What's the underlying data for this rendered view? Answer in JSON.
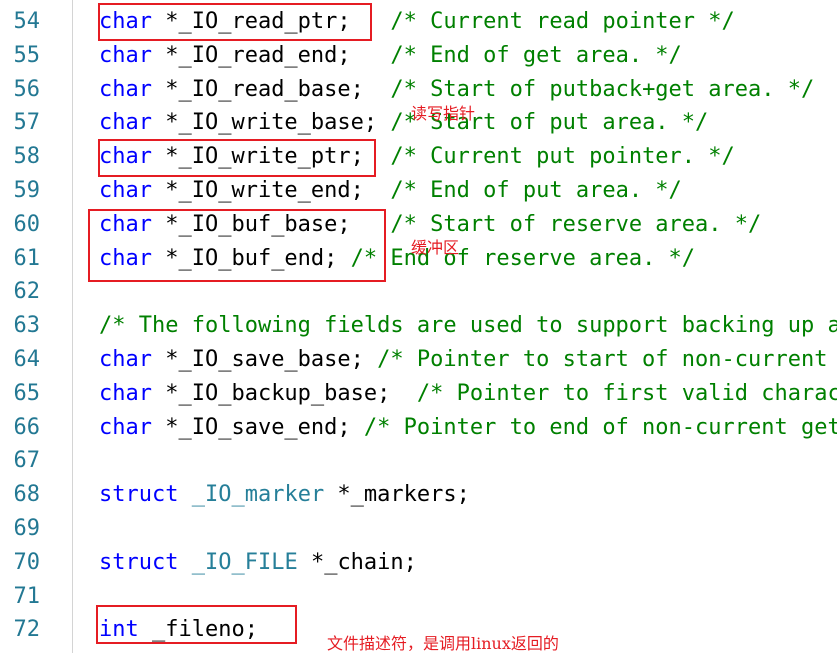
{
  "editor": {
    "lines": [
      {
        "num": "54",
        "parts": [
          {
            "t": "char",
            "c": "kw"
          },
          {
            "t": " *_IO_read_ptr;   ",
            "c": "tx"
          },
          {
            "t": "/* Current read pointer */",
            "c": "cm"
          }
        ]
      },
      {
        "num": "55",
        "parts": [
          {
            "t": "char",
            "c": "kw"
          },
          {
            "t": " *_IO_read_end;   ",
            "c": "tx"
          },
          {
            "t": "/* End of get area. */",
            "c": "cm"
          }
        ]
      },
      {
        "num": "56",
        "parts": [
          {
            "t": "char",
            "c": "kw"
          },
          {
            "t": " *_IO_read_base;  ",
            "c": "tx"
          },
          {
            "t": "/* Start of putback+get area. */",
            "c": "cm"
          }
        ]
      },
      {
        "num": "57",
        "parts": [
          {
            "t": "char",
            "c": "kw"
          },
          {
            "t": " *_IO_write_base; ",
            "c": "tx"
          },
          {
            "t": "/* Start of put area. */",
            "c": "cm"
          }
        ]
      },
      {
        "num": "58",
        "parts": [
          {
            "t": "char",
            "c": "kw"
          },
          {
            "t": " *_IO_write_ptr;  ",
            "c": "tx"
          },
          {
            "t": "/* Current put pointer. */",
            "c": "cm"
          }
        ]
      },
      {
        "num": "59",
        "parts": [
          {
            "t": "char",
            "c": "kw"
          },
          {
            "t": " *_IO_write_end;  ",
            "c": "tx"
          },
          {
            "t": "/* End of put area. */",
            "c": "cm"
          }
        ]
      },
      {
        "num": "60",
        "parts": [
          {
            "t": "char",
            "c": "kw"
          },
          {
            "t": " *_IO_buf_base;   ",
            "c": "tx"
          },
          {
            "t": "/* Start of reserve area. */",
            "c": "cm"
          }
        ]
      },
      {
        "num": "61",
        "parts": [
          {
            "t": "char",
            "c": "kw"
          },
          {
            "t": " *_IO_buf_end; ",
            "c": "tx"
          },
          {
            "t": "/* End of reserve area. */",
            "c": "cm"
          }
        ]
      },
      {
        "num": "62",
        "parts": []
      },
      {
        "num": "63",
        "parts": [
          {
            "t": "/* The following fields are used to support backing up and undo. */",
            "c": "cm"
          }
        ]
      },
      {
        "num": "64",
        "parts": [
          {
            "t": "char",
            "c": "kw"
          },
          {
            "t": " *_IO_save_base; ",
            "c": "tx"
          },
          {
            "t": "/* Pointer to start of non-current get area. */",
            "c": "cm"
          }
        ]
      },
      {
        "num": "65",
        "parts": [
          {
            "t": "char",
            "c": "kw"
          },
          {
            "t": " *_IO_backup_base;  ",
            "c": "tx"
          },
          {
            "t": "/* Pointer to first valid character of backup area */",
            "c": "cm"
          }
        ]
      },
      {
        "num": "66",
        "parts": [
          {
            "t": "char",
            "c": "kw"
          },
          {
            "t": " *_IO_save_end; ",
            "c": "tx"
          },
          {
            "t": "/* Pointer to end of non-current get area. */",
            "c": "cm"
          }
        ]
      },
      {
        "num": "67",
        "parts": []
      },
      {
        "num": "68",
        "parts": [
          {
            "t": "struct",
            "c": "kw"
          },
          {
            "t": " ",
            "c": "tx"
          },
          {
            "t": "_IO_marker",
            "c": "ty"
          },
          {
            "t": " *_markers;",
            "c": "tx"
          }
        ]
      },
      {
        "num": "69",
        "parts": []
      },
      {
        "num": "70",
        "parts": [
          {
            "t": "struct",
            "c": "kw"
          },
          {
            "t": " ",
            "c": "tx"
          },
          {
            "t": "_IO_FILE",
            "c": "ty"
          },
          {
            "t": " *_chain;",
            "c": "tx"
          }
        ]
      },
      {
        "num": "71",
        "parts": []
      },
      {
        "num": "72",
        "parts": [
          {
            "t": "int",
            "c": "kw"
          },
          {
            "t": " _fileno;",
            "c": "tx"
          }
        ]
      }
    ]
  },
  "annotations": {
    "read_write_pointer": "读写指针",
    "buffer": "缓冲区",
    "file_descriptor": "文件描述符，是调用linux返回的"
  },
  "colors": {
    "keyword": "#0000ff",
    "type": "#267f99",
    "comment": "#008000",
    "line_number": "#237893",
    "highlight_box": "#e51c23"
  }
}
